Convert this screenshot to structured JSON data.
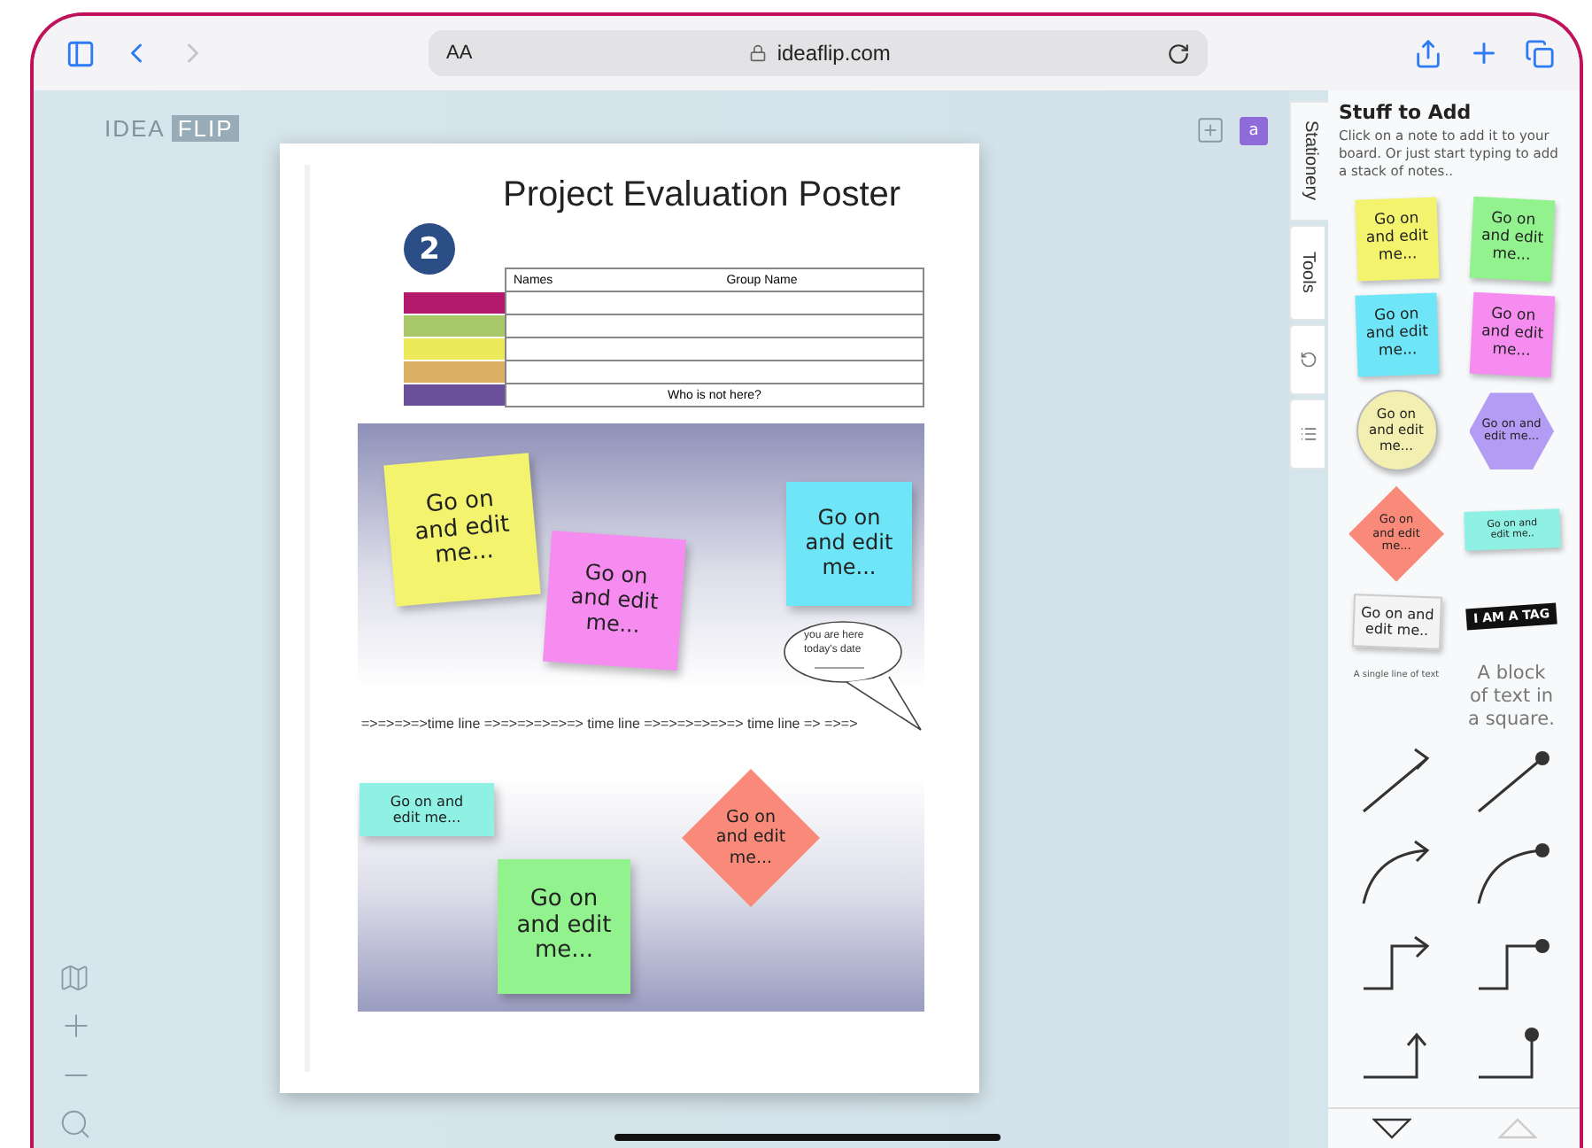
{
  "browser": {
    "text_size": "AA",
    "url": "ideaflip.com"
  },
  "logo": {
    "word": "IDEA",
    "boxed": "FLIP"
  },
  "avatar": "a",
  "poster": {
    "title": "Project Evaluation Poster",
    "badge": "2",
    "table": {
      "columns": [
        "Names",
        "Group Name"
      ],
      "rows": [
        {
          "color": "#b31a6b"
        },
        {
          "color": "#a9c86a"
        },
        {
          "color": "#ecea5a"
        },
        {
          "color": "#dbb063"
        },
        {
          "color": "#6a4f9a",
          "note": "Who is not here?"
        }
      ]
    },
    "notes": [
      {
        "kind": "square",
        "color": "#f3f36d",
        "lines": [
          "Go on",
          "and edit",
          "me..."
        ]
      },
      {
        "kind": "square",
        "color": "#f68cf0",
        "lines": [
          "Go on",
          "and edit",
          "me..."
        ]
      },
      {
        "kind": "square",
        "color": "#6ee6f7",
        "lines": [
          "Go on",
          "and edit",
          "me..."
        ]
      },
      {
        "kind": "bubble",
        "lines": [
          "you are here",
          "today's date"
        ]
      },
      {
        "kind": "strip",
        "color": "#8ff0e4",
        "lines": [
          "Go on and",
          "edit me..."
        ]
      },
      {
        "kind": "diamond",
        "color": "#f98a7a",
        "lines": [
          "Go on",
          "and edit",
          "me..."
        ]
      },
      {
        "kind": "square",
        "color": "#92f28e",
        "lines": [
          "Go on",
          "and edit",
          "me..."
        ]
      }
    ],
    "timeline": "=>=>=>=>time line =>=>=>=>=>=> time line =>=>=>=>=>=> time line => =>=>"
  },
  "side_tabs": [
    {
      "kind": "text",
      "label": "Stationery",
      "selected": true
    },
    {
      "kind": "text",
      "label": "Tools",
      "selected": false
    },
    {
      "kind": "undo",
      "selected": false
    },
    {
      "kind": "list",
      "selected": false
    }
  ],
  "panel": {
    "title": "Stuff to Add",
    "hint": "Click on a note to add it to your board. Or just start typing to add a stack of notes..",
    "items": [
      {
        "kind": "note",
        "color": "#f3f36d",
        "lines": [
          "Go on",
          "and edit",
          "me..."
        ]
      },
      {
        "kind": "note",
        "color": "#92f28e",
        "lines": [
          "Go on",
          "and edit",
          "me..."
        ]
      },
      {
        "kind": "note",
        "color": "#6ee6f7",
        "lines": [
          "Go on",
          "and edit",
          "me..."
        ]
      },
      {
        "kind": "note",
        "color": "#f68cf0",
        "lines": [
          "Go on",
          "and edit",
          "me..."
        ]
      },
      {
        "kind": "circle",
        "color": "#f3efb0",
        "lines": [
          "Go on",
          "and edit",
          "me..."
        ]
      },
      {
        "kind": "hexagon",
        "color": "#b49cf5",
        "lines": [
          "Go on and",
          "edit me..."
        ]
      },
      {
        "kind": "diamond",
        "color": "#f98a7a",
        "lines": [
          "Go on",
          "and edit",
          "me..."
        ]
      },
      {
        "kind": "strip",
        "color": "#8ff0e4",
        "lines": [
          "Go on and",
          "edit me.."
        ]
      },
      {
        "kind": "paper",
        "lines": [
          "Go on and",
          "edit me.."
        ]
      },
      {
        "kind": "tag",
        "lines": [
          "I AM A TAG"
        ]
      },
      {
        "kind": "line",
        "lines": [
          "A single line of text"
        ]
      },
      {
        "kind": "block",
        "lines": [
          "A block",
          "of text in",
          "a square."
        ]
      }
    ],
    "connectors": [
      {
        "kind": "straight-arrow"
      },
      {
        "kind": "straight-dot"
      },
      {
        "kind": "curve-arrow"
      },
      {
        "kind": "curve-dot"
      },
      {
        "kind": "elbow-arrow"
      },
      {
        "kind": "elbow-dot"
      },
      {
        "kind": "up-arrow"
      },
      {
        "kind": "up-dot"
      }
    ],
    "pager": {
      "down_disabled": false,
      "up_disabled": true
    }
  }
}
